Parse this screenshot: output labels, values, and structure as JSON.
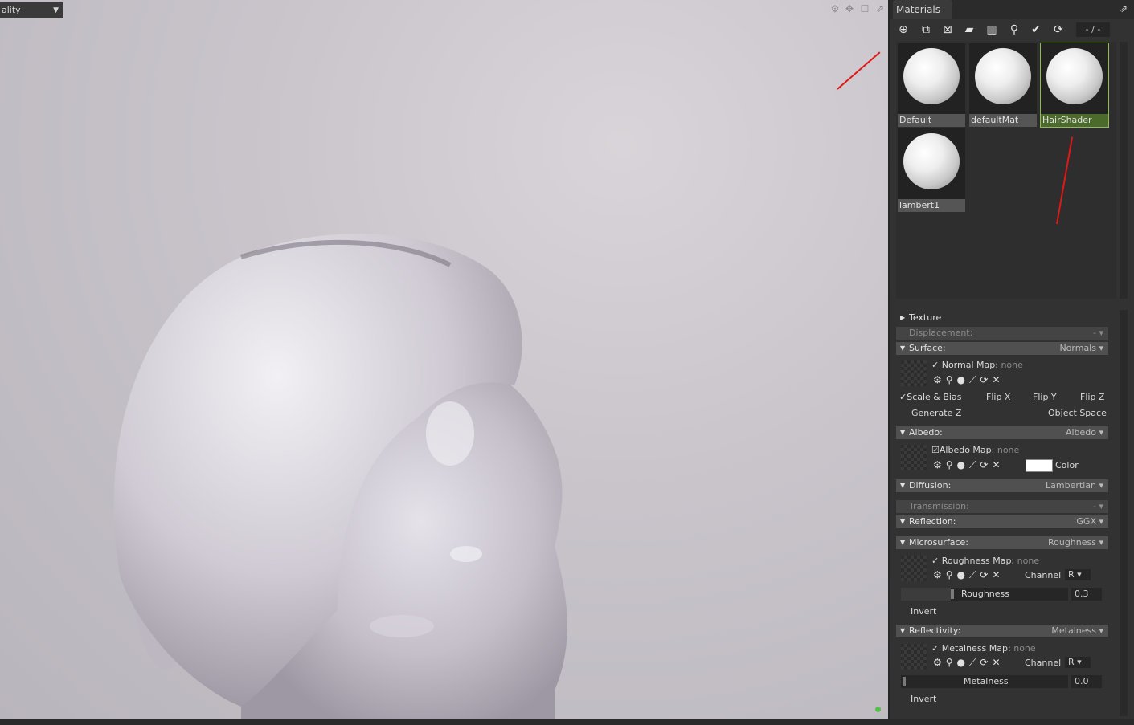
{
  "viewport": {
    "quality_label": "ality",
    "icons": [
      "gear-icon",
      "move-icon",
      "maximize-icon",
      "popout-icon"
    ]
  },
  "panel": {
    "title": "Materials",
    "counter": "- / -",
    "toolbar_icons": [
      "new-material-icon",
      "duplicate-icon",
      "checker-icon",
      "folder-icon",
      "delete-icon",
      "pick-icon",
      "apply-icon",
      "refresh-icon"
    ]
  },
  "materials": [
    {
      "name": "Default"
    },
    {
      "name": "defaultMat"
    },
    {
      "name": "HairShader",
      "selected": true
    },
    {
      "name": "lambert1"
    }
  ],
  "sections": {
    "texture": {
      "label": "Texture"
    },
    "displacement": {
      "label": "Displacement:",
      "value": "- ▾"
    },
    "surface": {
      "label": "Surface:",
      "value": "Normals ▾"
    },
    "normal_map": {
      "label": "Normal Map:",
      "value": "none"
    },
    "scale_bias": "Scale & Bias",
    "flip_x": "Flip X",
    "flip_y": "Flip Y",
    "flip_z": "Flip Z",
    "generate_z": "Generate Z",
    "object_space": "Object Space",
    "albedo": {
      "label": "Albedo:",
      "value": "Albedo ▾"
    },
    "albedo_map": {
      "label": "Albedo Map:",
      "value": "none"
    },
    "color_label": "Color",
    "diffusion": {
      "label": "Diffusion:",
      "value": "Lambertian ▾"
    },
    "transmission": {
      "label": "Transmission:",
      "value": "- ▾"
    },
    "reflection": {
      "label": "Reflection:",
      "value": "GGX ▾"
    },
    "microsurface": {
      "label": "Microsurface:",
      "value": "Roughness ▾"
    },
    "roughness_map": {
      "label": "Roughness Map:",
      "value": "none"
    },
    "channel_label": "Channel",
    "roughness_channel": "R",
    "roughness_label": "Roughness",
    "roughness_value": "0.3",
    "invert_label": "Invert",
    "reflectivity": {
      "label": "Reflectivity:",
      "value": "Metalness ▾"
    },
    "metalness_map": {
      "label": "Metalness Map:",
      "value": "none"
    },
    "metalness_channel": "R",
    "metalness_label": "Metalness",
    "metalness_value": "0.0"
  },
  "colors": {
    "accent": "#8dbb55",
    "arrow": "#e01818",
    "albedo_color": "#ffffff"
  }
}
